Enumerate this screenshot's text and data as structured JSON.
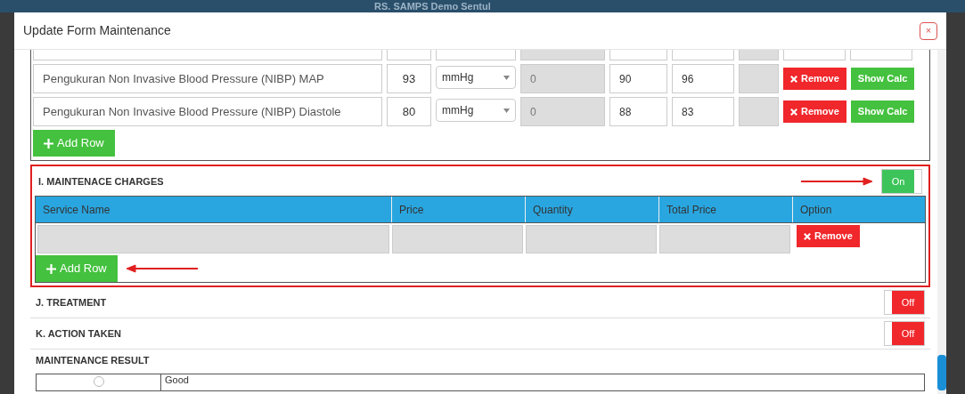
{
  "background": {
    "title": "RS. SAMPS Demo Sentul"
  },
  "modal": {
    "title": "Update Form Maintenance",
    "close": "×"
  },
  "measurements": {
    "rows": [
      {
        "name": "Pengukuran Non Invasive Blood Pressure (NIBP) MAP",
        "value": "93",
        "unit": "mmHg",
        "column_4": "0",
        "column_5": "90",
        "column_6": "96",
        "remove": "Remove",
        "calc": "Show Calc"
      },
      {
        "name": "Pengukuran Non Invasive Blood Pressure (NIBP) Diastole",
        "value": "80",
        "unit": "mmHg",
        "column_4": "0",
        "column_5": "88",
        "column_6": "83",
        "remove": "Remove",
        "calc": "Show Calc"
      }
    ],
    "add_row": "Add Row"
  },
  "sections": [
    {
      "title": "I. MAINTENACE CHARGES",
      "on": true,
      "toggle_label": "On",
      "highlighted": true,
      "table": {
        "columns": [
          "Service Name",
          "Price",
          "Quantity",
          "Total Price",
          "Option"
        ],
        "rows": [
          {
            "remove": "Remove"
          }
        ],
        "add_row": "Add Row"
      }
    },
    {
      "title": "J. TREATMENT",
      "on": false,
      "toggle_label": "Off",
      "highlighted": false
    },
    {
      "title": "K. ACTION TAKEN",
      "on": false,
      "toggle_label": "Off",
      "highlighted": false
    }
  ],
  "result": {
    "title": "MAINTENANCE RESULT",
    "options": [
      {
        "label": "Good",
        "selected": false
      }
    ]
  }
}
